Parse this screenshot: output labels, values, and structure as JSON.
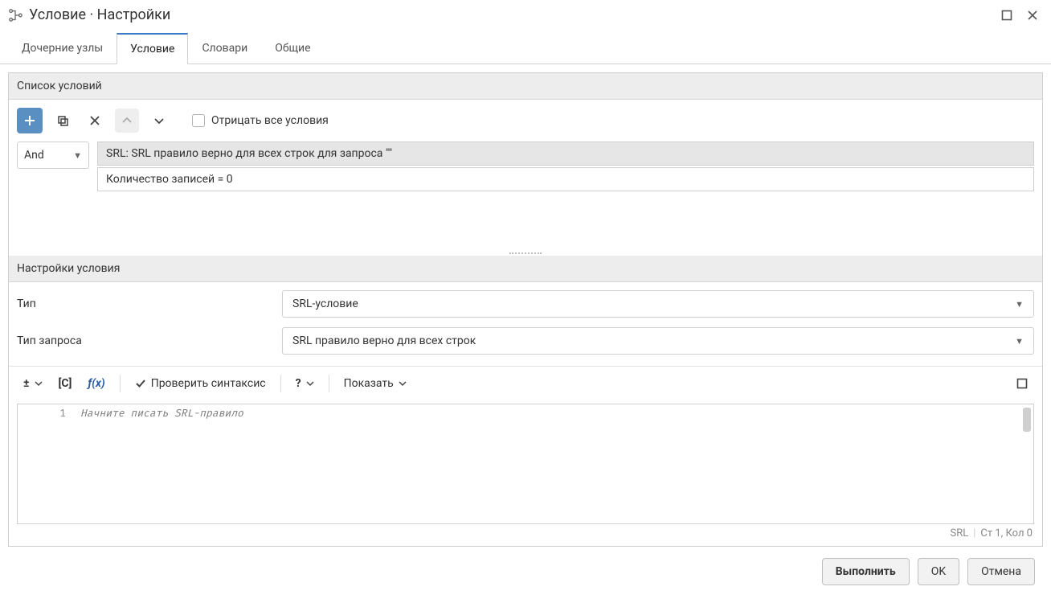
{
  "window": {
    "title": "Условие · Настройки"
  },
  "tabs": [
    {
      "label": "Дочерние узлы",
      "active": false
    },
    {
      "label": "Условие",
      "active": true
    },
    {
      "label": "Словари",
      "active": false
    },
    {
      "label": "Общие",
      "active": false
    }
  ],
  "conditions": {
    "headerLabel": "Список условий",
    "operator": "And",
    "negateLabel": "Отрицать все условия",
    "negateChecked": false,
    "rows": [
      {
        "text": "SRL: SRL правило верно для всех строк для запроса \"\"",
        "selected": true
      },
      {
        "text": "Количество записей = 0",
        "selected": false
      }
    ]
  },
  "settings": {
    "headerLabel": "Настройки условия",
    "typeLabel": "Тип",
    "typeValue": "SRL-условие",
    "queryLabel": "Тип запроса",
    "queryValue": "SRL правило верно для всех строк"
  },
  "editorToolbar": {
    "pmGlyph": "±",
    "cGlyph": "[C]",
    "fxGlyph": "ƒ(x)",
    "checkLabel": "Проверить синтаксис",
    "helpGlyph": "?",
    "showLabel": "Показать"
  },
  "editor": {
    "lineNo": "1",
    "placeholder": "Начните писать SRL-правило"
  },
  "editorStatus": {
    "lang": "SRL",
    "pos": "Ст 1, Кол 0"
  },
  "footer": {
    "runLabel": "Выполнить",
    "okLabel": "OK",
    "cancelLabel": "Отмена"
  }
}
